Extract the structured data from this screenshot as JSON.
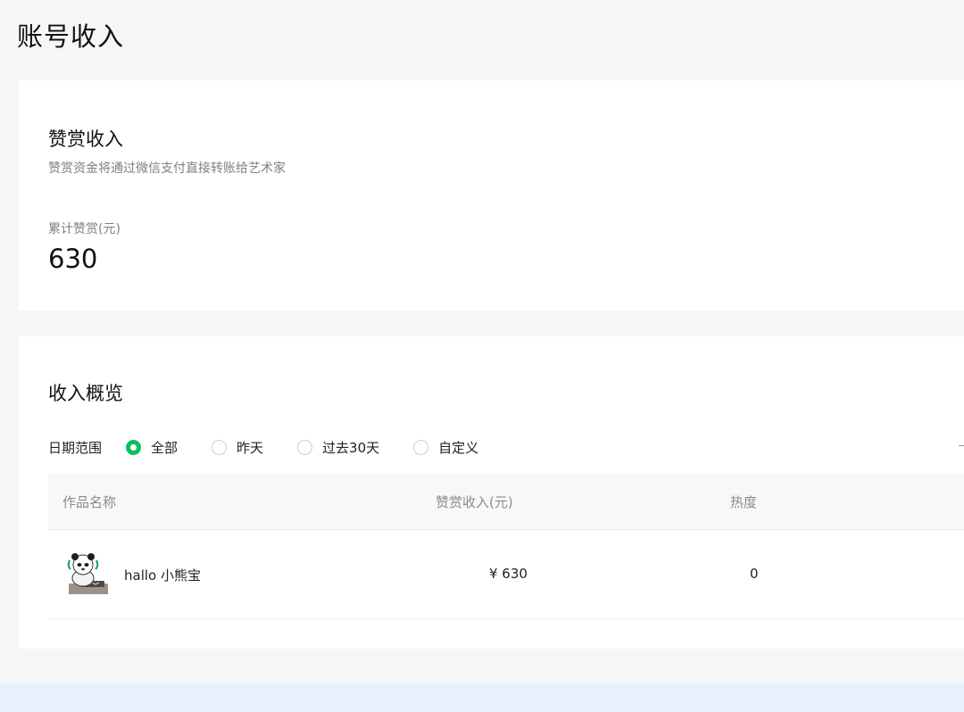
{
  "page": {
    "title": "账号收入"
  },
  "reward": {
    "title": "赞赏收入",
    "description": "赞赏资金将通过微信支付直接转账给艺术家",
    "total_label": "累计赞赏(元)",
    "total_value": "630"
  },
  "overview": {
    "title": "收入概览",
    "filter": {
      "label": "日期范围",
      "options": [
        {
          "label": "全部",
          "selected": true
        },
        {
          "label": "昨天",
          "selected": false
        },
        {
          "label": "过去30天",
          "selected": false
        },
        {
          "label": "自定义",
          "selected": false
        }
      ]
    },
    "table": {
      "headers": [
        "作品名称",
        "赞赏收入(元)",
        "热度"
      ],
      "rows": [
        {
          "name": "hallo 小熊宝",
          "income": "¥ 630",
          "heat": "0",
          "thumbnail_icon": "panda-sticker-thumbnail"
        }
      ]
    }
  },
  "colors": {
    "accent": "#07c160",
    "background": "#f5f6f8",
    "bottom_bar": "#e7f1fc"
  }
}
